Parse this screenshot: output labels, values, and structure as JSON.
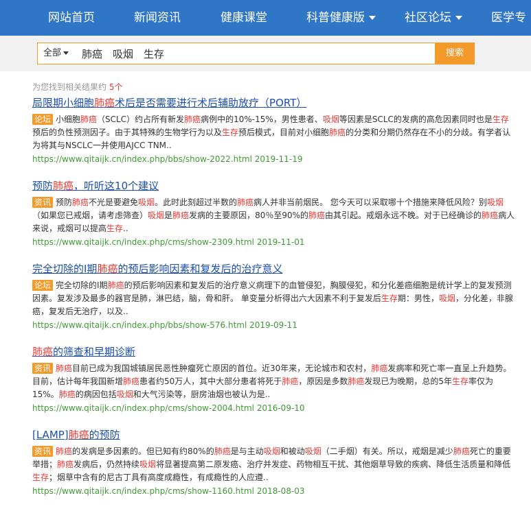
{
  "nav": {
    "items": [
      {
        "label": "网站首页",
        "dropdown": false
      },
      {
        "label": "新闻资讯",
        "dropdown": false
      },
      {
        "label": "健康课堂",
        "dropdown": false
      },
      {
        "label": "科普健康版",
        "dropdown": true
      },
      {
        "label": "社区论坛",
        "dropdown": true
      },
      {
        "label": "医学专",
        "dropdown": false
      }
    ]
  },
  "search": {
    "scope": "全部",
    "query": "肺癌　吸烟　生存",
    "button": "搜索"
  },
  "results_count": {
    "prefix": "为您找到相关结果约",
    "count": "5个"
  },
  "colors": {
    "nav_bg": "#2f76c7",
    "accent": "#f39a2a",
    "highlight": "#e53935",
    "link": "#1b4fb5",
    "url": "#3f9b34"
  },
  "results": [
    {
      "title": [
        {
          "t": "局限期小细胞",
          "h": false
        },
        {
          "t": "肺癌",
          "h": true
        },
        {
          "t": "术后是否需要进行术后辅助放疗（PORT）",
          "h": false
        }
      ],
      "badge": "论坛",
      "snippet": [
        {
          "t": "小细胞",
          "h": false
        },
        {
          "t": "肺癌",
          "h": true
        },
        {
          "t": "（SCLC）约占所有新发",
          "h": false
        },
        {
          "t": "肺癌",
          "h": true
        },
        {
          "t": "病例中的10%-15%，男性患者、",
          "h": false
        },
        {
          "t": "吸烟",
          "h": true
        },
        {
          "t": "等因素是SCLC的发病的高危因素同时也是",
          "h": false
        },
        {
          "t": "生存",
          "h": true
        },
        {
          "t": "预后的负性预测因子。由于其特殊的生物学行为以及",
          "h": false
        },
        {
          "t": "生存",
          "h": true
        },
        {
          "t": "预后模式，目前对小细胞",
          "h": false
        },
        {
          "t": "肺癌",
          "h": true
        },
        {
          "t": "的分类和分期仍然存在不小的分歧。有学者认为将其与NSCLC一并使用AJCC TNM..",
          "h": false
        }
      ],
      "url": "https://www.qitaijk.cn/index.php/bbs/show-2022.html 2019-11-19"
    },
    {
      "title": [
        {
          "t": "预防",
          "h": false
        },
        {
          "t": "肺癌",
          "h": true
        },
        {
          "t": "，听听这10个建议",
          "h": false
        }
      ],
      "badge": "资讯",
      "snippet": [
        {
          "t": "预防",
          "h": false
        },
        {
          "t": "肺癌",
          "h": true
        },
        {
          "t": "不光是要避免",
          "h": false
        },
        {
          "t": "吸烟",
          "h": true
        },
        {
          "t": "。此时此刻超过半数的",
          "h": false
        },
        {
          "t": "肺癌",
          "h": true
        },
        {
          "t": "病人并非当前烟民。 您今天可以采取哪十个措施来降低风险？别",
          "h": false
        },
        {
          "t": "吸烟",
          "h": true
        },
        {
          "t": "（如果您已戒烟，请考虑筛查）",
          "h": false
        },
        {
          "t": "吸烟",
          "h": true
        },
        {
          "t": "是",
          "h": false
        },
        {
          "t": "肺癌",
          "h": true
        },
        {
          "t": "发病的主要原因，80％至90%的",
          "h": false
        },
        {
          "t": "肺癌",
          "h": true
        },
        {
          "t": "由其引起。戒烟永远不晚。对于已经确诊的",
          "h": false
        },
        {
          "t": "肺癌",
          "h": true
        },
        {
          "t": "病人来说，戒烟可以提高",
          "h": false
        },
        {
          "t": "生存",
          "h": true
        },
        {
          "t": "..",
          "h": false
        }
      ],
      "url": "https://www.qitaijk.cn/index.php/cms/show-2309.html 2019-11-01"
    },
    {
      "title": [
        {
          "t": "完全切除的I期",
          "h": false
        },
        {
          "t": "肺癌",
          "h": true
        },
        {
          "t": "的预后影响因素和复发后的治疗意义",
          "h": false
        }
      ],
      "badge": "论坛",
      "snippet": [
        {
          "t": "完全切除的I期",
          "h": false
        },
        {
          "t": "肺癌",
          "h": true
        },
        {
          "t": "的预后影响因素和复发后的治疗意义病理下的血管侵犯，胸膜侵犯，和分化差癌细胞是统计学上的复发预测因素。复发涉及最多的器官是肺，淋巴结，脑，骨和肝。 单变量分析得出六大因素不利于复发后",
          "h": false
        },
        {
          "t": "生存",
          "h": true
        },
        {
          "t": "期：男性，",
          "h": false
        },
        {
          "t": "吸烟",
          "h": true
        },
        {
          "t": "，分化差，非腺癌，复发后无治疗，以及..",
          "h": false
        }
      ],
      "url": "https://www.qitaijk.cn/index.php/bbs/show-576.html 2019-09-11"
    },
    {
      "title": [
        {
          "t": "肺癌",
          "h": true
        },
        {
          "t": "的筛查和早期诊断",
          "h": false
        }
      ],
      "badge": "资讯",
      "snippet": [
        {
          "t": "肺癌",
          "h": true
        },
        {
          "t": "目前已成为我国城镇居民恶性肿瘤死亡原因的首位。近30年来，无论城市和农村，",
          "h": false
        },
        {
          "t": "肺癌",
          "h": true
        },
        {
          "t": "发病率和死亡率一直呈上升趋势。目前，估计每年我国新增",
          "h": false
        },
        {
          "t": "肺癌",
          "h": true
        },
        {
          "t": "患者约50万人，其中大部分患者将死于",
          "h": false
        },
        {
          "t": "肺癌",
          "h": true
        },
        {
          "t": "，原因是多数",
          "h": false
        },
        {
          "t": "肺癌",
          "h": true
        },
        {
          "t": "发现已为晚期，总的5年",
          "h": false
        },
        {
          "t": "生存",
          "h": true
        },
        {
          "t": "率仅为15%。",
          "h": false
        },
        {
          "t": "肺癌",
          "h": true
        },
        {
          "t": "的病因包括",
          "h": false
        },
        {
          "t": "吸烟",
          "h": true
        },
        {
          "t": "和大气污染等，厨房油烟也被认为是..",
          "h": false
        }
      ],
      "url": "https://www.qitaijk.cn/index.php/cms/show-2004.html 2016-09-10"
    },
    {
      "title": [
        {
          "t": "[LAMP]",
          "h": false
        },
        {
          "t": "肺癌",
          "h": true
        },
        {
          "t": "的预防",
          "h": false
        }
      ],
      "badge": "资讯",
      "snippet": [
        {
          "t": "肺癌",
          "h": true
        },
        {
          "t": "的发病是多因素的。但已知有约80%的",
          "h": false
        },
        {
          "t": "肺癌",
          "h": true
        },
        {
          "t": "是与主动",
          "h": false
        },
        {
          "t": "吸烟",
          "h": true
        },
        {
          "t": "和被动",
          "h": false
        },
        {
          "t": "吸烟",
          "h": true
        },
        {
          "t": "（二手烟）有关。所以，戒烟是减少",
          "h": false
        },
        {
          "t": "肺癌",
          "h": true
        },
        {
          "t": "死亡的重要举措；",
          "h": false
        },
        {
          "t": "肺癌",
          "h": true
        },
        {
          "t": "发病后，仍然持续",
          "h": false
        },
        {
          "t": "吸烟",
          "h": true
        },
        {
          "t": "将显著提高第二原发癌、治疗并发症、药物相互干扰、其他烟草导致的疾病、降低生活质量和降低",
          "h": false
        },
        {
          "t": "生存",
          "h": true
        },
        {
          "t": "；烟草中含有的尼古丁具有高度成瘾性，有成瘾性的人应遵..",
          "h": false
        }
      ],
      "url": "https://www.qitaijk.cn/index.php/cms/show-1160.html 2018-08-03"
    }
  ]
}
